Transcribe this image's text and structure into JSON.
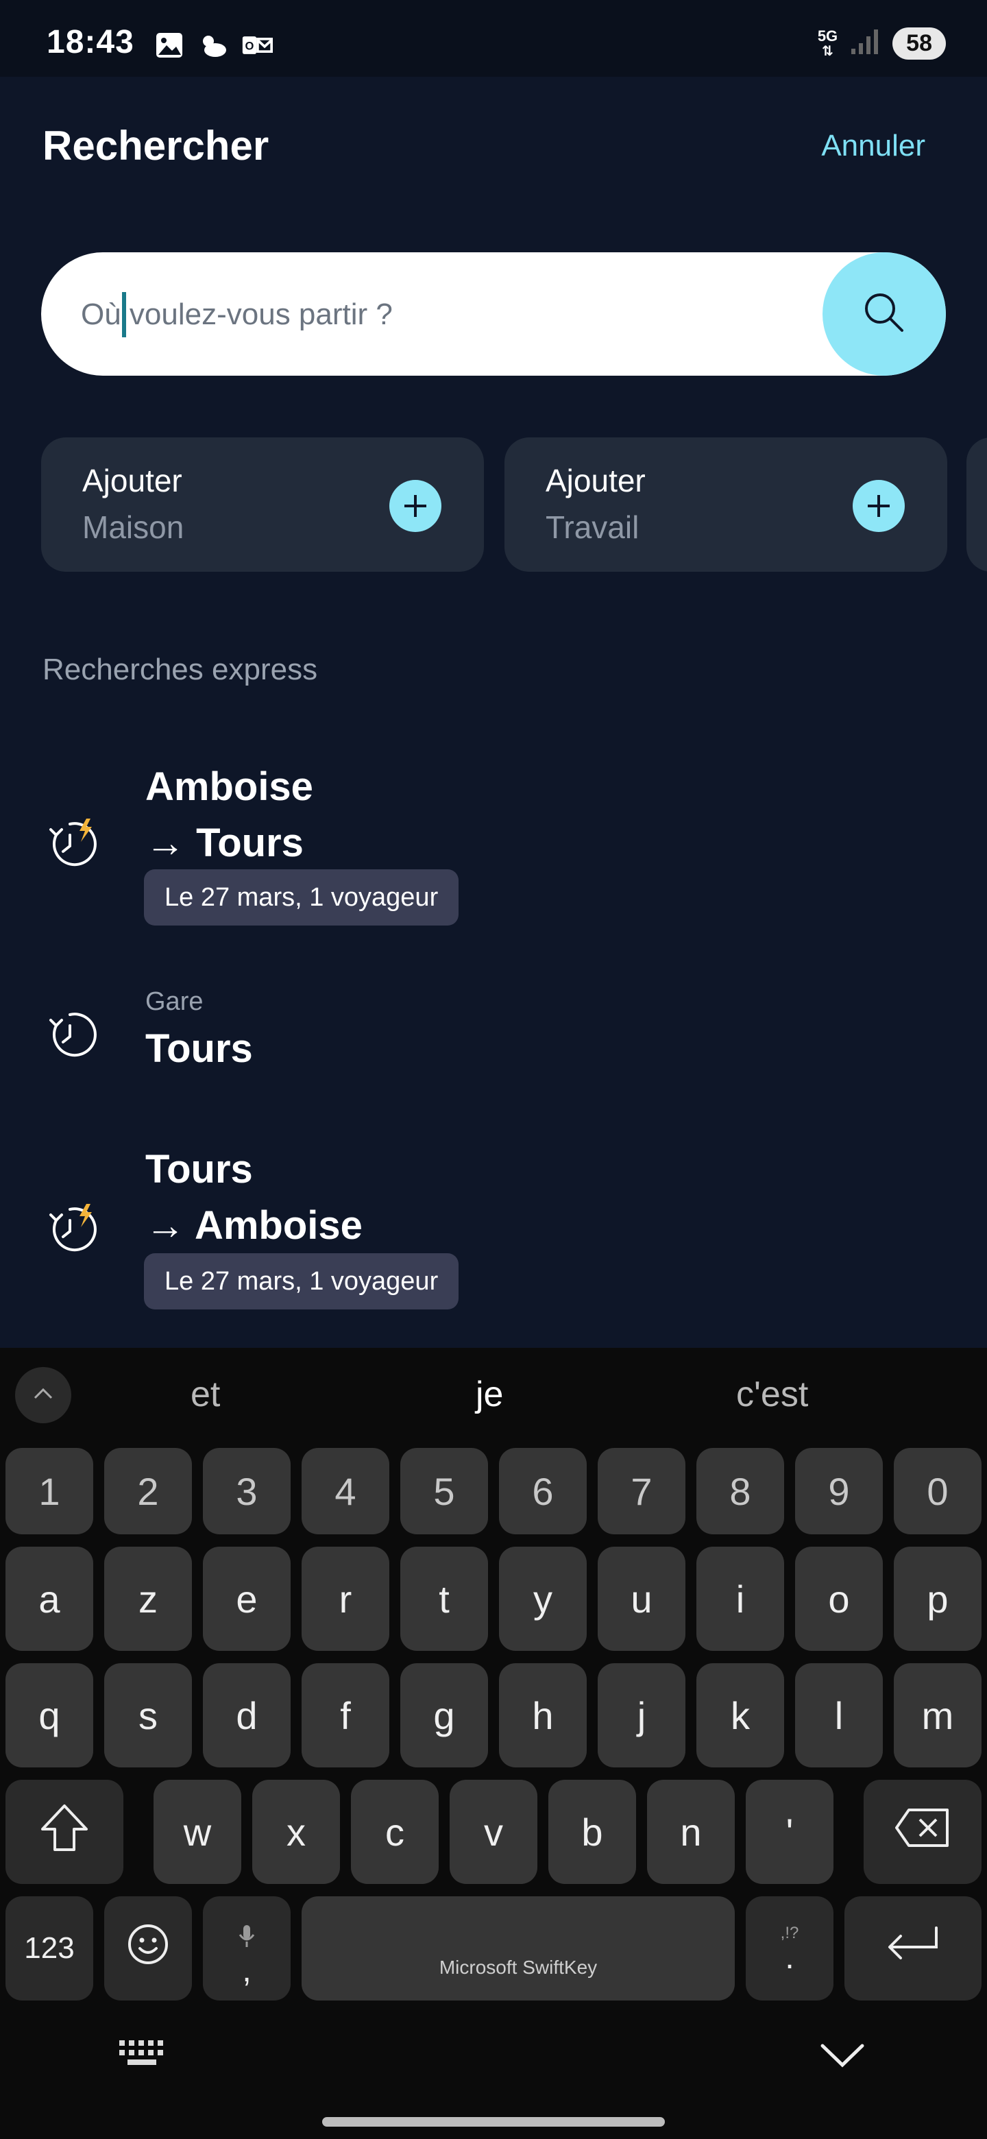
{
  "status_bar": {
    "time": "18:43",
    "network": "5G",
    "battery": "58"
  },
  "header": {
    "title": "Rechercher",
    "cancel_label": "Annuler"
  },
  "search": {
    "placeholder": "Où voulez-vous partir ?"
  },
  "shortcuts": [
    {
      "line1": "Ajouter",
      "line2": "Maison"
    },
    {
      "line1": "Ajouter",
      "line2": "Travail"
    }
  ],
  "section_title": "Recherches express",
  "history": [
    {
      "from": "Amboise",
      "to": "→ Tours",
      "badge": "Le 27 mars, 1 voyageur"
    },
    {
      "kind": "Gare",
      "name": "Tours"
    },
    {
      "from": "Tours",
      "to": "→ Amboise",
      "badge": "Le 27 mars, 1 voyageur"
    }
  ],
  "keyboard": {
    "suggestions": [
      "et",
      "je",
      "c'est"
    ],
    "row_numbers": [
      "1",
      "2",
      "3",
      "4",
      "5",
      "6",
      "7",
      "8",
      "9",
      "0"
    ],
    "row1": [
      "a",
      "z",
      "e",
      "r",
      "t",
      "y",
      "u",
      "i",
      "o",
      "p"
    ],
    "row2": [
      "q",
      "s",
      "d",
      "f",
      "g",
      "h",
      "j",
      "k",
      "l",
      "m"
    ],
    "row3": [
      "w",
      "x",
      "c",
      "v",
      "b",
      "n",
      "'"
    ],
    "numbers_key": "123",
    "comma_key": ",",
    "space_label": "Microsoft SwiftKey",
    "period_key": ".",
    "period_hint": ",!?"
  },
  "colors": {
    "accent": "#8ee6f7",
    "background": "#0e1628",
    "card": "#222b3a"
  }
}
